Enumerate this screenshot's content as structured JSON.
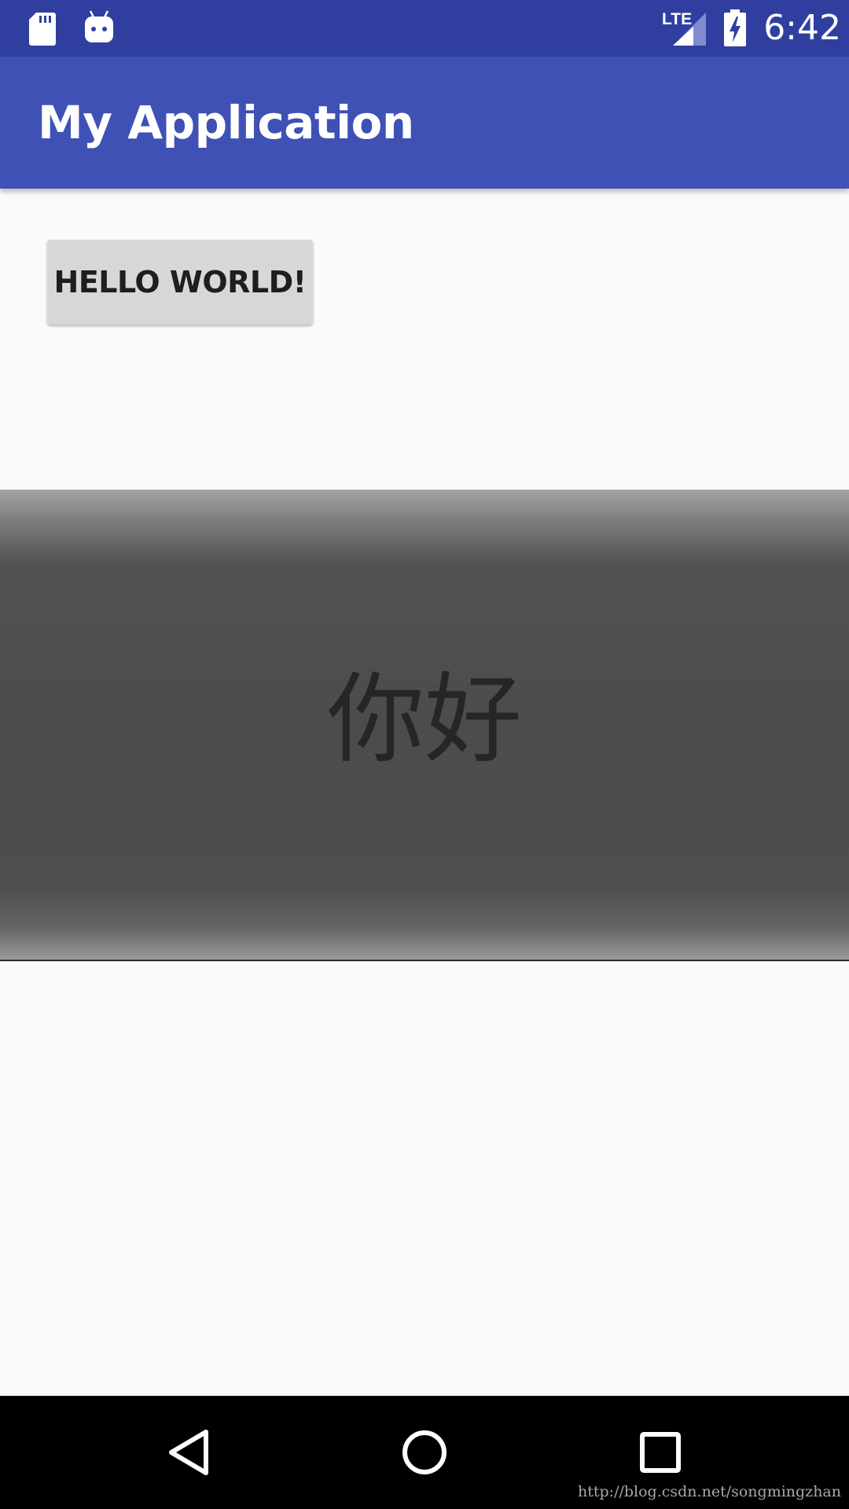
{
  "status_bar": {
    "time": "6:42",
    "network_label": "LTE",
    "icons": [
      "sd-card-icon",
      "android-icon",
      "lte-signal-icon",
      "battery-charging-icon"
    ]
  },
  "app_bar": {
    "title": "My Application"
  },
  "main": {
    "button_label": "HELLO WORLD!",
    "banner_text": "你好"
  },
  "nav_bar": {
    "icons": [
      "back-icon",
      "home-icon",
      "recent-apps-icon"
    ]
  },
  "watermark": "http://blog.csdn.net/songmingzhan",
  "colors": {
    "status_bar": "#303f9f",
    "app_bar": "#3f51b5",
    "background": "#fafafa",
    "button": "#d7d7d7",
    "banner": "#4d4b4b",
    "nav_bar": "#000000"
  }
}
